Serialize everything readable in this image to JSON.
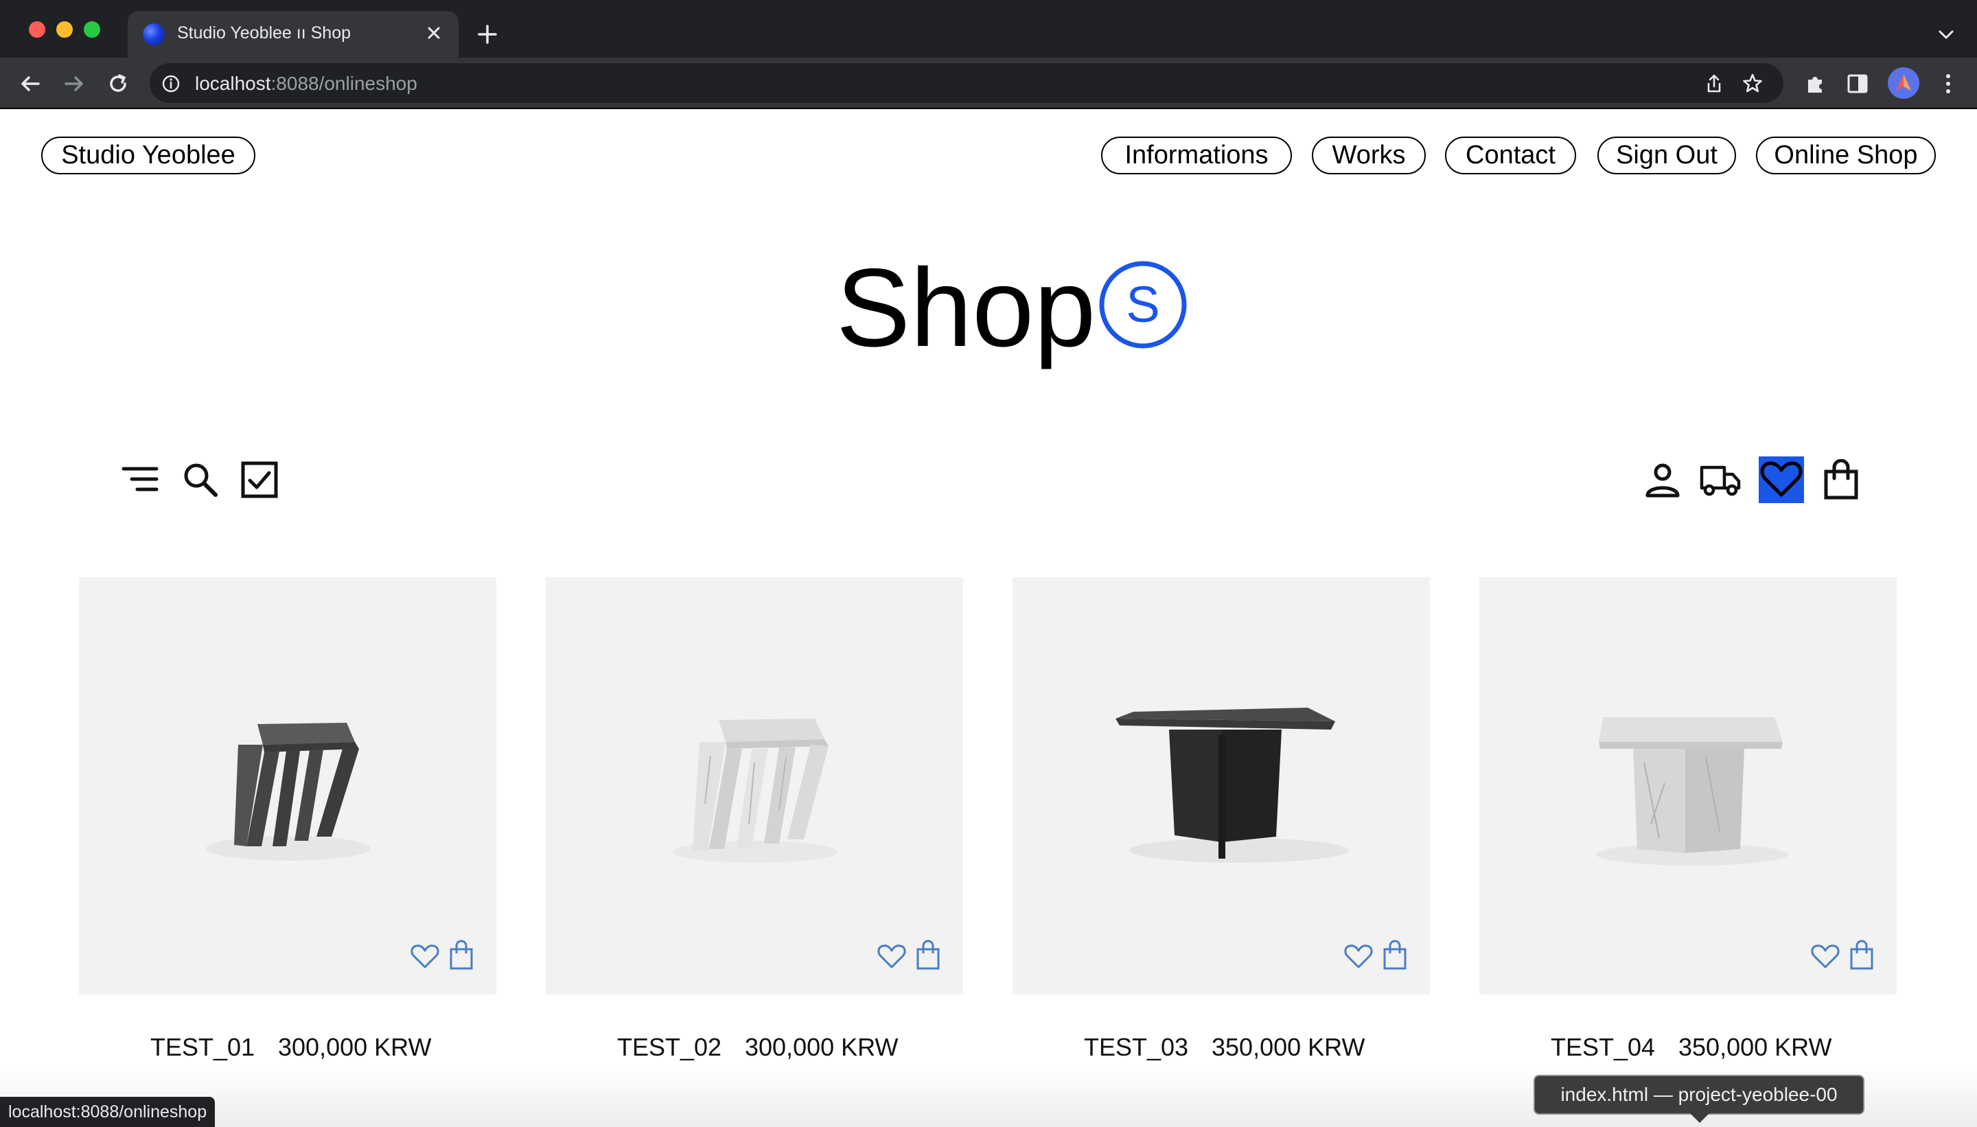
{
  "browser": {
    "tab_title": "Studio Yeoblee ıı Shop",
    "url_host": "localhost",
    "url_path": ":8088/onlineshop",
    "status_text": "localhost:8088/onlineshop",
    "tooltip": "index.html — project-yeoblee-00"
  },
  "nav": {
    "brand": "Studio Yeoblee",
    "links": [
      "Informations",
      "Works",
      "Contact",
      "Sign Out",
      "Online Shop"
    ]
  },
  "hero": {
    "title": "Shop",
    "badge_letter": "S",
    "badge_color": "#1a56e8"
  },
  "shop_toolbar": {
    "left_icons": [
      "menu-icon",
      "search-icon",
      "checkbox-icon"
    ],
    "right_icons": [
      "user-icon",
      "truck-icon",
      "heart-icon",
      "shopping-bag-icon"
    ],
    "active_icon": "heart-icon",
    "active_color": "#1a56e8"
  },
  "products": [
    {
      "name": "TEST_01",
      "price": "300,000 KRW",
      "material": "dark stone stool"
    },
    {
      "name": "TEST_02",
      "price": "300,000 KRW",
      "material": "white marble stool"
    },
    {
      "name": "TEST_03",
      "price": "350,000 KRW",
      "material": "dark stone table"
    },
    {
      "name": "TEST_04",
      "price": "350,000 KRW",
      "material": "white marble table"
    }
  ],
  "colors": {
    "chrome_dark": "#202124",
    "chrome_mid": "#35363a",
    "accent_blue": "#1a56e8",
    "product_icon_blue": "#4a7fc1"
  }
}
